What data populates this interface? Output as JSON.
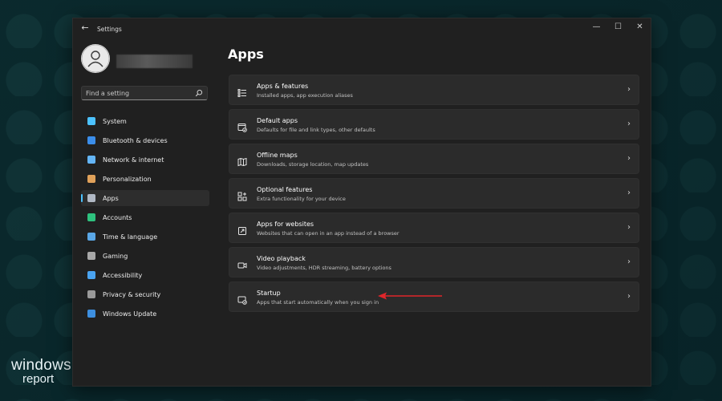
{
  "window": {
    "title": "Settings",
    "controls": {
      "minimize": "—",
      "maximize": "☐",
      "close": "✕"
    }
  },
  "search": {
    "placeholder": "Find a setting"
  },
  "sidebar": {
    "items": [
      {
        "label": "System",
        "icon": "monitor-icon",
        "color": "#4cc2ff"
      },
      {
        "label": "Bluetooth & devices",
        "icon": "bluetooth-icon",
        "color": "#3b8eea"
      },
      {
        "label": "Network & internet",
        "icon": "wifi-icon",
        "color": "#64b5f6"
      },
      {
        "label": "Personalization",
        "icon": "brush-icon",
        "color": "#e0a15a"
      },
      {
        "label": "Apps",
        "icon": "apps-icon",
        "color": "#b0b8c4"
      },
      {
        "label": "Accounts",
        "icon": "person-icon",
        "color": "#2ec27e"
      },
      {
        "label": "Time & language",
        "icon": "globe-clock-icon",
        "color": "#5aa7e6"
      },
      {
        "label": "Gaming",
        "icon": "gamepad-icon",
        "color": "#a8a8a8"
      },
      {
        "label": "Accessibility",
        "icon": "accessibility-icon",
        "color": "#4aa3f0"
      },
      {
        "label": "Privacy & security",
        "icon": "shield-icon",
        "color": "#9a9a9a"
      },
      {
        "label": "Windows Update",
        "icon": "update-icon",
        "color": "#3d8fe0"
      }
    ],
    "active_index": 4
  },
  "main": {
    "title": "Apps",
    "cards": [
      {
        "title": "Apps & features",
        "desc": "Installed apps, app execution aliases",
        "icon": "list-icon"
      },
      {
        "title": "Default apps",
        "desc": "Defaults for file and link types, other defaults",
        "icon": "default-apps-icon"
      },
      {
        "title": "Offline maps",
        "desc": "Downloads, storage location, map updates",
        "icon": "map-icon"
      },
      {
        "title": "Optional features",
        "desc": "Extra functionality for your device",
        "icon": "grid-plus-icon"
      },
      {
        "title": "Apps for websites",
        "desc": "Websites that can open in an app instead of a browser",
        "icon": "web-app-icon"
      },
      {
        "title": "Video playback",
        "desc": "Video adjustments, HDR streaming, battery options",
        "icon": "video-icon"
      },
      {
        "title": "Startup",
        "desc": "Apps that start automatically when you sign in",
        "icon": "startup-icon"
      }
    ]
  },
  "annotation": {
    "color": "#e0262b"
  },
  "brand": {
    "line1": "windows",
    "line2": "report"
  }
}
